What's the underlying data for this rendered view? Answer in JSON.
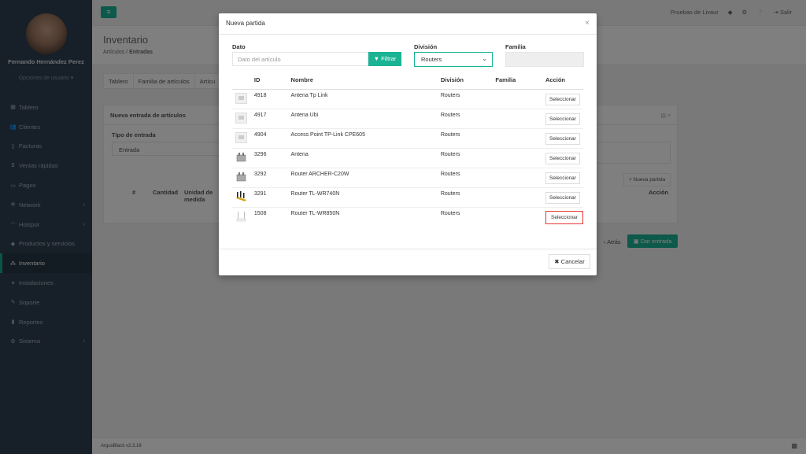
{
  "sidebar": {
    "user_name": "Fernando Hernández Perez",
    "user_options": "Opciones de usuario ▾",
    "items": [
      {
        "icon": "dashboard-icon",
        "glyph": "▦",
        "label": "Tablero",
        "submenu": false
      },
      {
        "icon": "users-icon",
        "glyph": "👥",
        "label": "Clientes",
        "submenu": false
      },
      {
        "icon": "file-icon",
        "glyph": "▯",
        "label": "Facturas",
        "submenu": false
      },
      {
        "icon": "dollar-icon",
        "glyph": "$",
        "label": "Ventas rápidas",
        "submenu": false
      },
      {
        "icon": "money-icon",
        "glyph": "▭",
        "label": "Pagos",
        "submenu": false
      },
      {
        "icon": "network-icon",
        "glyph": "✻",
        "label": "Network",
        "submenu": true
      },
      {
        "icon": "wifi-icon",
        "glyph": "◠",
        "label": "Hotspot",
        "submenu": true
      },
      {
        "icon": "tag-icon",
        "glyph": "◆",
        "label": "Productos y servicios",
        "submenu": false
      },
      {
        "icon": "cubes-icon",
        "glyph": "⁂",
        "label": "Inventario",
        "submenu": false,
        "active": true
      },
      {
        "icon": "gears-icon",
        "glyph": "✦",
        "label": "Instalaciones",
        "submenu": false
      },
      {
        "icon": "wrench-icon",
        "glyph": "✎",
        "label": "Soporte",
        "submenu": false
      },
      {
        "icon": "book-icon",
        "glyph": "▮",
        "label": "Reportes",
        "submenu": false
      },
      {
        "icon": "cogs-icon",
        "glyph": "⚙",
        "label": "Sistema",
        "submenu": true
      }
    ]
  },
  "topbar": {
    "menu_icon": "≡",
    "account": "Pruebas de Livaur",
    "logout": "Salir"
  },
  "page": {
    "title": "Inventario",
    "breadcrumb_parent": "Artículos",
    "breadcrumb_sep": " / ",
    "breadcrumb_current": "Entradas",
    "tabs": [
      "Tablero",
      "Familia de artículos",
      "Artícu"
    ]
  },
  "panel": {
    "title": "Nueva entrada de artículos",
    "tipo_label": "Tipo de entrada",
    "tipo_value": "Entrada",
    "nueva_partida": "+ Nueva partida",
    "col_num": "#",
    "col_cantidad": "Cantidad",
    "col_unidad": "Unidad de medida",
    "col_accion": "Acción"
  },
  "actions": {
    "back": "‹ Atrás",
    "submit": "Dar entrada"
  },
  "footer": {
    "version": "ArgusBlack v2.3.18"
  },
  "modal": {
    "title": "Nueva partida",
    "close": "×",
    "dato_label": "Dato",
    "dato_placeholder": "Dato del artículo",
    "filtrar": "Filtrar",
    "division_label": "División",
    "division_value": "Routers",
    "familia_label": "Familia",
    "headers": {
      "id": "ID",
      "nombre": "Nombre",
      "division": "División",
      "familia": "Familia",
      "accion": "Acción"
    },
    "rows": [
      {
        "id": "4918",
        "nombre": "Antena Tp Link",
        "division": "Routers",
        "familia": "",
        "accion": "Seleccionar",
        "thumb": "placeholder"
      },
      {
        "id": "4917",
        "nombre": "Antena Ubi",
        "division": "Routers",
        "familia": "",
        "accion": "Seleccionar",
        "thumb": "placeholder"
      },
      {
        "id": "4904",
        "nombre": "Access Point TP-Link CPE605",
        "division": "Routers",
        "familia": "",
        "accion": "Seleccionar",
        "thumb": "placeholder"
      },
      {
        "id": "3296",
        "nombre": "Antena",
        "division": "Routers",
        "familia": "",
        "accion": "Seleccionar",
        "thumb": "device"
      },
      {
        "id": "3292",
        "nombre": "Router ARCHER-C20W",
        "division": "Routers",
        "familia": "",
        "accion": "Seleccionar",
        "thumb": "device"
      },
      {
        "id": "3291",
        "nombre": "Router TL-WR740N",
        "division": "Routers",
        "familia": "",
        "accion": "Seleccionar",
        "thumb": "router-yellow"
      },
      {
        "id": "1508",
        "nombre": "Router TL-WR850N",
        "division": "Routers",
        "familia": "",
        "accion": "Seleccionar",
        "thumb": "router-white",
        "highlighted": true
      }
    ],
    "cancel": "Cancelar"
  }
}
